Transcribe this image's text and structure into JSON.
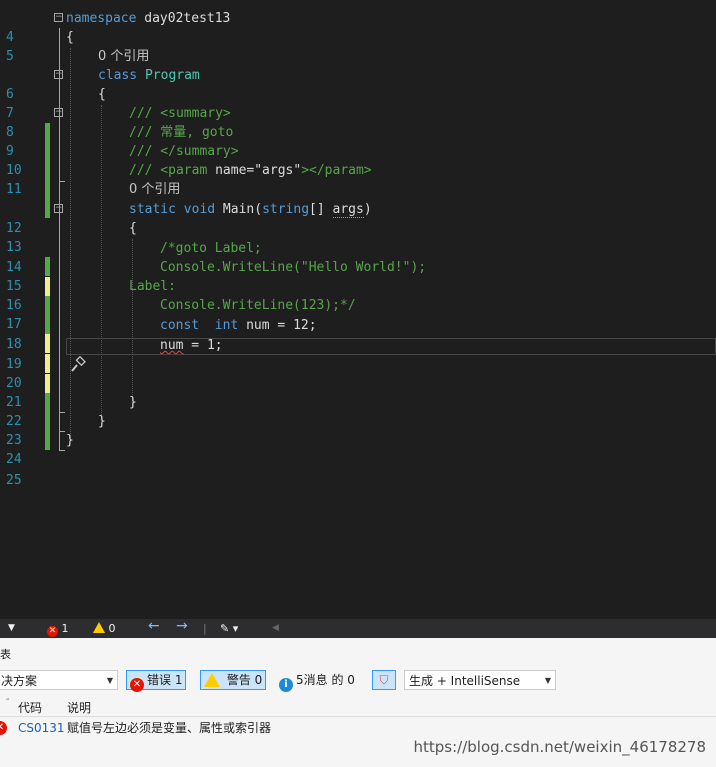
{
  "editor": {
    "lines": [
      {
        "num": "4"
      },
      {
        "num": "5"
      },
      {
        "num": ""
      },
      {
        "num": "6"
      },
      {
        "num": "7"
      },
      {
        "num": "8"
      },
      {
        "num": "9"
      },
      {
        "num": "10"
      },
      {
        "num": "11"
      },
      {
        "num": ""
      },
      {
        "num": "12"
      },
      {
        "num": "13"
      },
      {
        "num": "14"
      },
      {
        "num": "15"
      },
      {
        "num": "16"
      },
      {
        "num": "17"
      },
      {
        "num": "18"
      },
      {
        "num": "19"
      },
      {
        "num": "20"
      },
      {
        "num": "21"
      },
      {
        "num": "22"
      },
      {
        "num": "23"
      },
      {
        "num": "24"
      },
      {
        "num": "25"
      }
    ],
    "code": {
      "ns_kw": "namespace",
      "ns_name": " day02test13",
      "brace_open": "{",
      "refs1": "0 个引用",
      "class_kw": "class",
      "class_name": " Program",
      "c8": "/// <summary>",
      "c9": "/// 常量, goto",
      "c10": "/// </summary>",
      "c11a": "/// <param ",
      "c11b": "name=\"args\"",
      "c11c": "></param>",
      "refs2": "0 个引用",
      "static_kw": "static void ",
      "main": "Main(",
      "string_kw": "string",
      "args_a": "[] ",
      "args_b": "args",
      "args_c": ")",
      "l14": "/*goto Label;",
      "l15": "Console.WriteLine(\"Hello World!\");",
      "l16": "Label:",
      "l17": "Console.WriteLine(123);*/",
      "const_kw": "const  int",
      "l18b": " num = 12;",
      "l19a": "num",
      "l19b": " = 1;",
      "brace_close": "}"
    }
  },
  "statusbar": {
    "errors": "1",
    "warnings": "0"
  },
  "error_list": {
    "title": "表",
    "scope": "决方案",
    "errors_btn": "错误 1",
    "warnings_btn": "警告 0",
    "messages_btn": "5消息 的 0",
    "build_filter": "生成 + IntelliSense",
    "col_code": "代码",
    "col_desc": "说明",
    "row_code": "CS0131",
    "row_desc": "赋值号左边必须是变量、属性或索引器"
  },
  "watermark": "https://blog.csdn.net/weixin_46178278",
  "colors": {
    "keyword": "#569cd6",
    "class": "#4ec9b0",
    "comment": "#57a64a",
    "linenumber": "#2b91af",
    "error": "#e51400"
  }
}
